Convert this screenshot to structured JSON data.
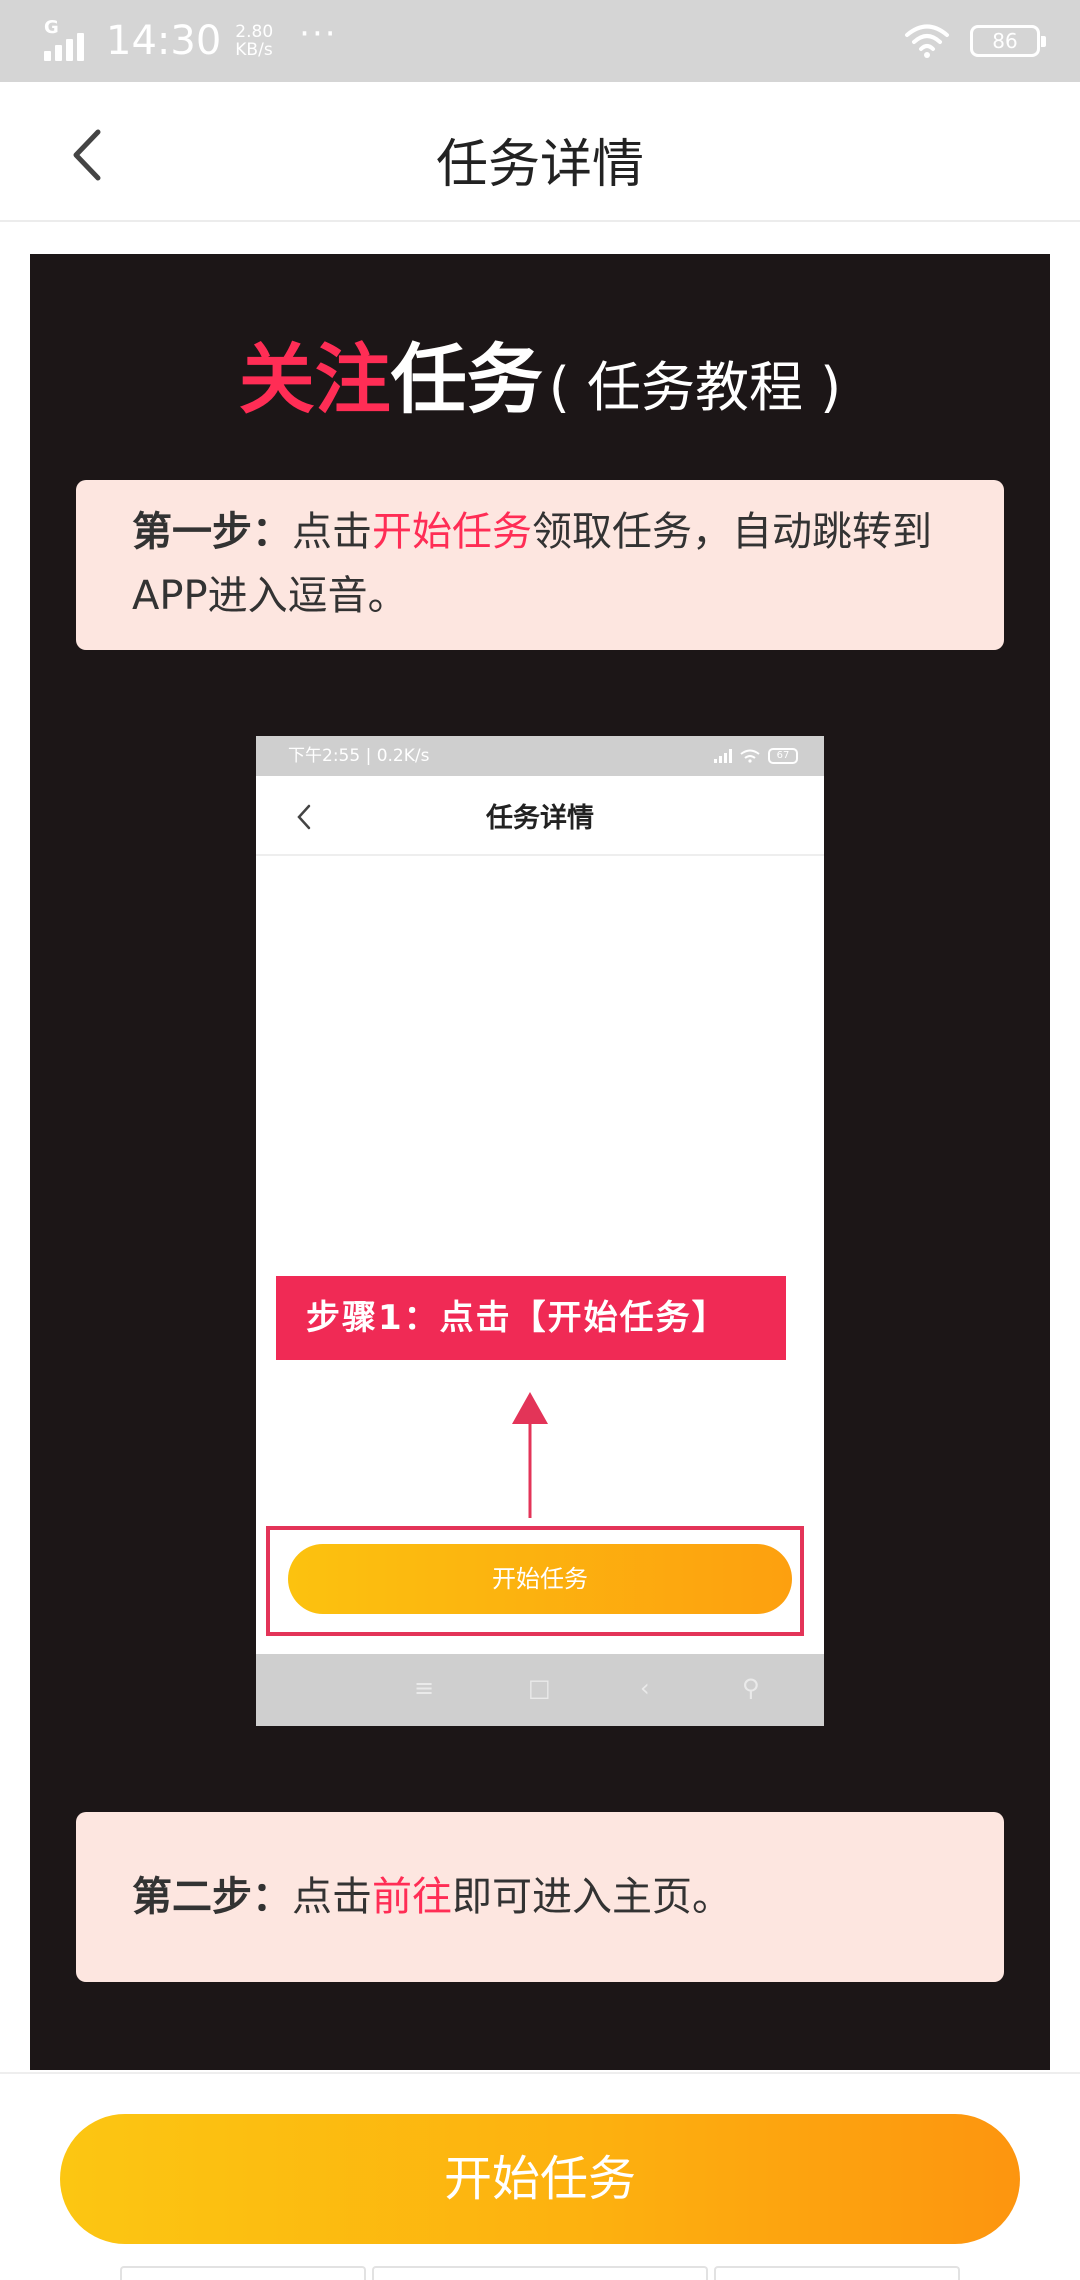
{
  "status_bar": {
    "network": "G",
    "time": "14:30",
    "speed_value": "2.80",
    "speed_unit": "KB/s",
    "more": "···",
    "battery": "86"
  },
  "nav": {
    "title": "任务详情"
  },
  "tutorial": {
    "title_accent": "关注",
    "title_main": "任务",
    "title_sub": "( 任务教程 )",
    "step1": {
      "lead": "第一步：",
      "text_before": "点击",
      "highlight": "开始任务",
      "text_after": "领取任务，自动跳转到APP进入逗音。"
    },
    "step2": {
      "lead": "第二步：",
      "text_before": "点击",
      "highlight": "前往",
      "text_after": "即可进入主页。"
    },
    "screenshot": {
      "status_text": "下午2:55 | 0.2K/s",
      "battery": "67",
      "title": "任务详情",
      "banner": "步骤1：点击【开始任务】",
      "button": "开始任务",
      "nav_menu": "≡",
      "nav_home": "□",
      "nav_back": "‹",
      "nav_accessibility": "⚲"
    }
  },
  "footer": {
    "start_button": "开始任务"
  },
  "colors": {
    "accent_red": "#ff2d55",
    "button_gradient_start": "#fcc612",
    "button_gradient_end": "#fd950f",
    "panel_bg": "#1c1617",
    "card_bg": "#fde6e0"
  }
}
